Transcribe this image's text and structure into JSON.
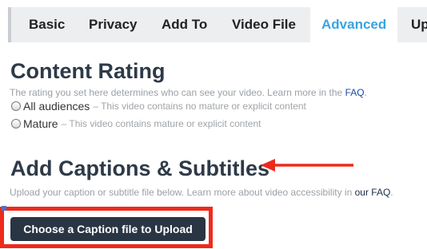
{
  "tabs": [
    {
      "label": "Basic",
      "active": false
    },
    {
      "label": "Privacy",
      "active": false
    },
    {
      "label": "Add To",
      "active": false
    },
    {
      "label": "Video File",
      "active": false
    },
    {
      "label": "Advanced",
      "active": true
    },
    {
      "label": "Upg",
      "active": false
    }
  ],
  "content_rating": {
    "title": "Content Rating",
    "description": "The rating you set here determines who can see your video. Learn more in the",
    "faq_link": "FAQ",
    "options": [
      {
        "label": "All audiences",
        "note": "– This video contains no mature or explicit content",
        "selected": false
      },
      {
        "label": "Mature",
        "note": "– This video contains mature or explicit content",
        "selected": false
      }
    ]
  },
  "captions": {
    "title": "Add Captions & Subtitles",
    "description": "Upload your caption or subtitle file below. Learn more about video accessibility in",
    "faq_link": "our FAQ",
    "upload_button": "Choose a Caption file to Upload"
  },
  "colors": {
    "active_tab": "#3aa4e0",
    "annotation_red": "#ee2a1b",
    "button_bg": "#2a3544"
  }
}
